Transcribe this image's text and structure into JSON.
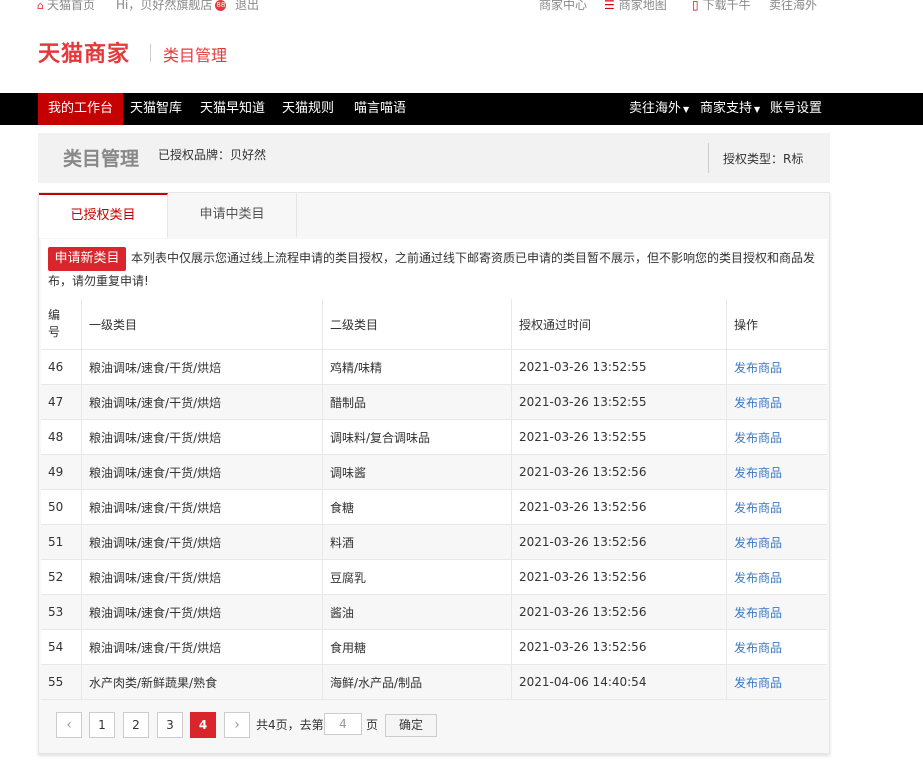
{
  "topbar": {
    "home": "天猫首页",
    "greeting": "Hi，贝好然旗舰店",
    "badge": "88",
    "logout": "退出",
    "merchant_center": "商家中心",
    "merchant_map": "商家地图",
    "download": "下载千牛",
    "sell_overseas": "卖往海外"
  },
  "header": {
    "logo": "天猫商家",
    "subtitle": "类目管理"
  },
  "nav": {
    "left": [
      "我的工作台",
      "天猫智库",
      "天猫早知道",
      "天猫规则",
      "喵言喵语"
    ],
    "right": [
      "卖往海外",
      "商家支持",
      "账号设置"
    ]
  },
  "infobar": {
    "title": "类目管理",
    "brand": "已授权品牌：贝好然",
    "auth_type": "授权类型：R标"
  },
  "tabs": [
    "已授权类目",
    "申请中类目"
  ],
  "notice": {
    "apply_button": "申请新类目",
    "text": "本列表中仅展示您通过线上流程申请的类目授权，之前通过线下邮寄资质已申请的类目暂不展示，但不影响您的类目授权和商品发布，请勿重复申请!"
  },
  "table": {
    "headers": [
      "编号",
      "一级类目",
      "二级类目",
      "授权通过时间",
      "操作"
    ],
    "rows": [
      {
        "id": "46",
        "l1": "粮油调味/速食/干货/烘焙",
        "l2": "鸡精/味精",
        "time": "2021-03-26 13:52:55",
        "action": "发布商品"
      },
      {
        "id": "47",
        "l1": "粮油调味/速食/干货/烘焙",
        "l2": "醋制品",
        "time": "2021-03-26 13:52:55",
        "action": "发布商品"
      },
      {
        "id": "48",
        "l1": "粮油调味/速食/干货/烘焙",
        "l2": "调味料/复合调味品",
        "time": "2021-03-26 13:52:55",
        "action": "发布商品"
      },
      {
        "id": "49",
        "l1": "粮油调味/速食/干货/烘焙",
        "l2": "调味酱",
        "time": "2021-03-26 13:52:56",
        "action": "发布商品"
      },
      {
        "id": "50",
        "l1": "粮油调味/速食/干货/烘焙",
        "l2": "食糖",
        "time": "2021-03-26 13:52:56",
        "action": "发布商品"
      },
      {
        "id": "51",
        "l1": "粮油调味/速食/干货/烘焙",
        "l2": "料酒",
        "time": "2021-03-26 13:52:56",
        "action": "发布商品"
      },
      {
        "id": "52",
        "l1": "粮油调味/速食/干货/烘焙",
        "l2": "豆腐乳",
        "time": "2021-03-26 13:52:56",
        "action": "发布商品"
      },
      {
        "id": "53",
        "l1": "粮油调味/速食/干货/烘焙",
        "l2": "酱油",
        "time": "2021-03-26 13:52:56",
        "action": "发布商品"
      },
      {
        "id": "54",
        "l1": "粮油调味/速食/干货/烘焙",
        "l2": "食用糖",
        "time": "2021-03-26 13:52:56",
        "action": "发布商品"
      },
      {
        "id": "55",
        "l1": "水产肉类/新鲜蔬果/熟食",
        "l2": "海鲜/水产品/制品",
        "time": "2021-04-06 14:40:54",
        "action": "发布商品"
      }
    ]
  },
  "pager": {
    "prev": "‹",
    "next": "›",
    "pages": [
      "1",
      "2",
      "3",
      "4"
    ],
    "current": "4",
    "total_text": "共4页，去第",
    "goto_value": "4",
    "page_suffix": "页",
    "confirm": "确定"
  },
  "colors": {
    "brand_red": "#e4393c",
    "nav_active": "#c40000",
    "link_blue": "#3a78c3"
  }
}
